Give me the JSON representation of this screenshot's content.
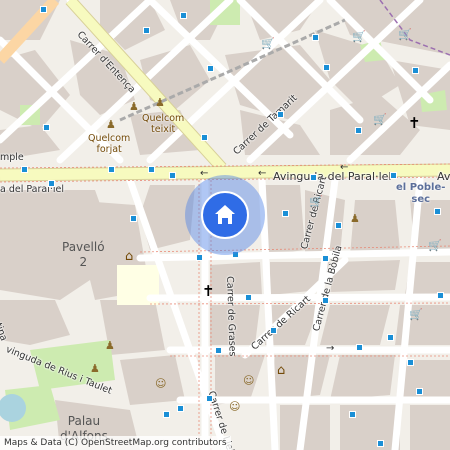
{
  "streets": {
    "entenca": "Carrer d'Entença",
    "tamarit": "Carrer de Tamarit",
    "parallel": "Avinguda del Paral·lel",
    "parallel_left": "a del Paral·lel",
    "parallel_right": "Av",
    "ricart_v": "Carrer de Ricart",
    "ricart_d": "Carrer de Ricart",
    "blesa": "Carrer de la Bòbila",
    "grases": "Carrer de Grases",
    "lleida": "Carrer de Lleid",
    "rius": "vinguda de Rius i Taulet",
    "tina": "tina",
    "mple": "mple"
  },
  "places": {
    "quelcom_teixit": "Quelcom\nteixit",
    "quelcom_forjat": "Quelcom\nforjat",
    "poble_sec": "el Poble-\nsec",
    "pavello": "Pavelló\n2",
    "palau": "Palau\nd'Alfons"
  },
  "attribution": "Maps & Data (C) OpenStreetMap.org contributors",
  "icons": {
    "cart": "cart-icon",
    "church": "church-icon",
    "theatre": "theatre-icon",
    "museum": "museum-icon",
    "marker": "home-icon"
  },
  "colors": {
    "land": "#f2efe9",
    "built": "#d9d0c9",
    "road": "#ffffff",
    "primary": "#f7fabf",
    "marker": "#2f6ce6",
    "halo": "#5082e6",
    "stop": "#1a8fd6",
    "water": "#aad3df",
    "park": "#cdebb0"
  }
}
